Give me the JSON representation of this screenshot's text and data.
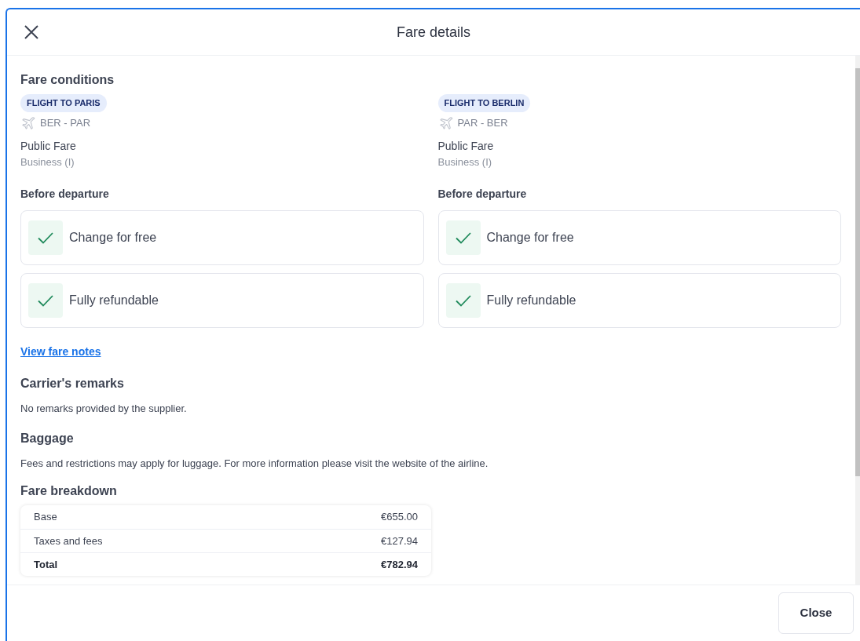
{
  "dialog": {
    "title": "Fare details"
  },
  "fare_conditions": {
    "heading": "Fare conditions",
    "flights": [
      {
        "tag": "FLIGHT TO PARIS",
        "route": "BER - PAR",
        "fare_type": "Public Fare",
        "cabin": "Business (I)",
        "section": "Before departure",
        "conditions": [
          {
            "label": "Change for free",
            "included": true
          },
          {
            "label": "Fully refundable",
            "included": true
          }
        ]
      },
      {
        "tag": "FLIGHT TO BERLIN",
        "route": "PAR - BER",
        "fare_type": "Public Fare",
        "cabin": "Business (I)",
        "section": "Before departure",
        "conditions": [
          {
            "label": "Change for free",
            "included": true
          },
          {
            "label": "Fully refundable",
            "included": true
          }
        ]
      }
    ],
    "link": "View fare notes"
  },
  "carrier_remarks": {
    "heading": "Carrier's remarks",
    "text": "No remarks provided by the supplier."
  },
  "baggage": {
    "heading": "Baggage",
    "text": "Fees and restrictions may apply for luggage. For more information please visit the website of the airline."
  },
  "fare_breakdown": {
    "heading": "Fare breakdown",
    "rows": [
      {
        "label": "Base",
        "amount": "€655.00",
        "total": false
      },
      {
        "label": "Taxes and fees",
        "amount": "€127.94",
        "total": false
      },
      {
        "label": "Total",
        "amount": "€782.94",
        "total": true
      }
    ]
  },
  "footer": {
    "button": "Close"
  }
}
